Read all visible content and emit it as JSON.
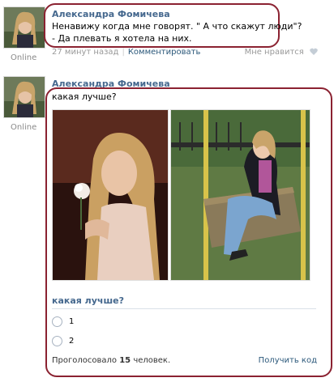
{
  "post1": {
    "author": "Александра Фомичева",
    "status": "Online",
    "text_line1": "Ненавижу когда мне говорят. \" А что скажут люди\"?",
    "text_line2": "- Да плевать я хотела на них.",
    "time": "27 минут назад",
    "comment_link": "Комментировать",
    "like_label": "Мне нравится"
  },
  "post2": {
    "author": "Александра Фомичева",
    "status": "Online",
    "text": "какая лучше?",
    "poll": {
      "title": "какая лучше?",
      "options": [
        "1",
        "2"
      ],
      "votes_prefix": "Проголосовало",
      "votes_count": "15",
      "votes_suffix": "человек.",
      "get_code": "Получить код"
    }
  },
  "colors": {
    "link": "#45688e",
    "highlight_oval": "#8b2231"
  }
}
